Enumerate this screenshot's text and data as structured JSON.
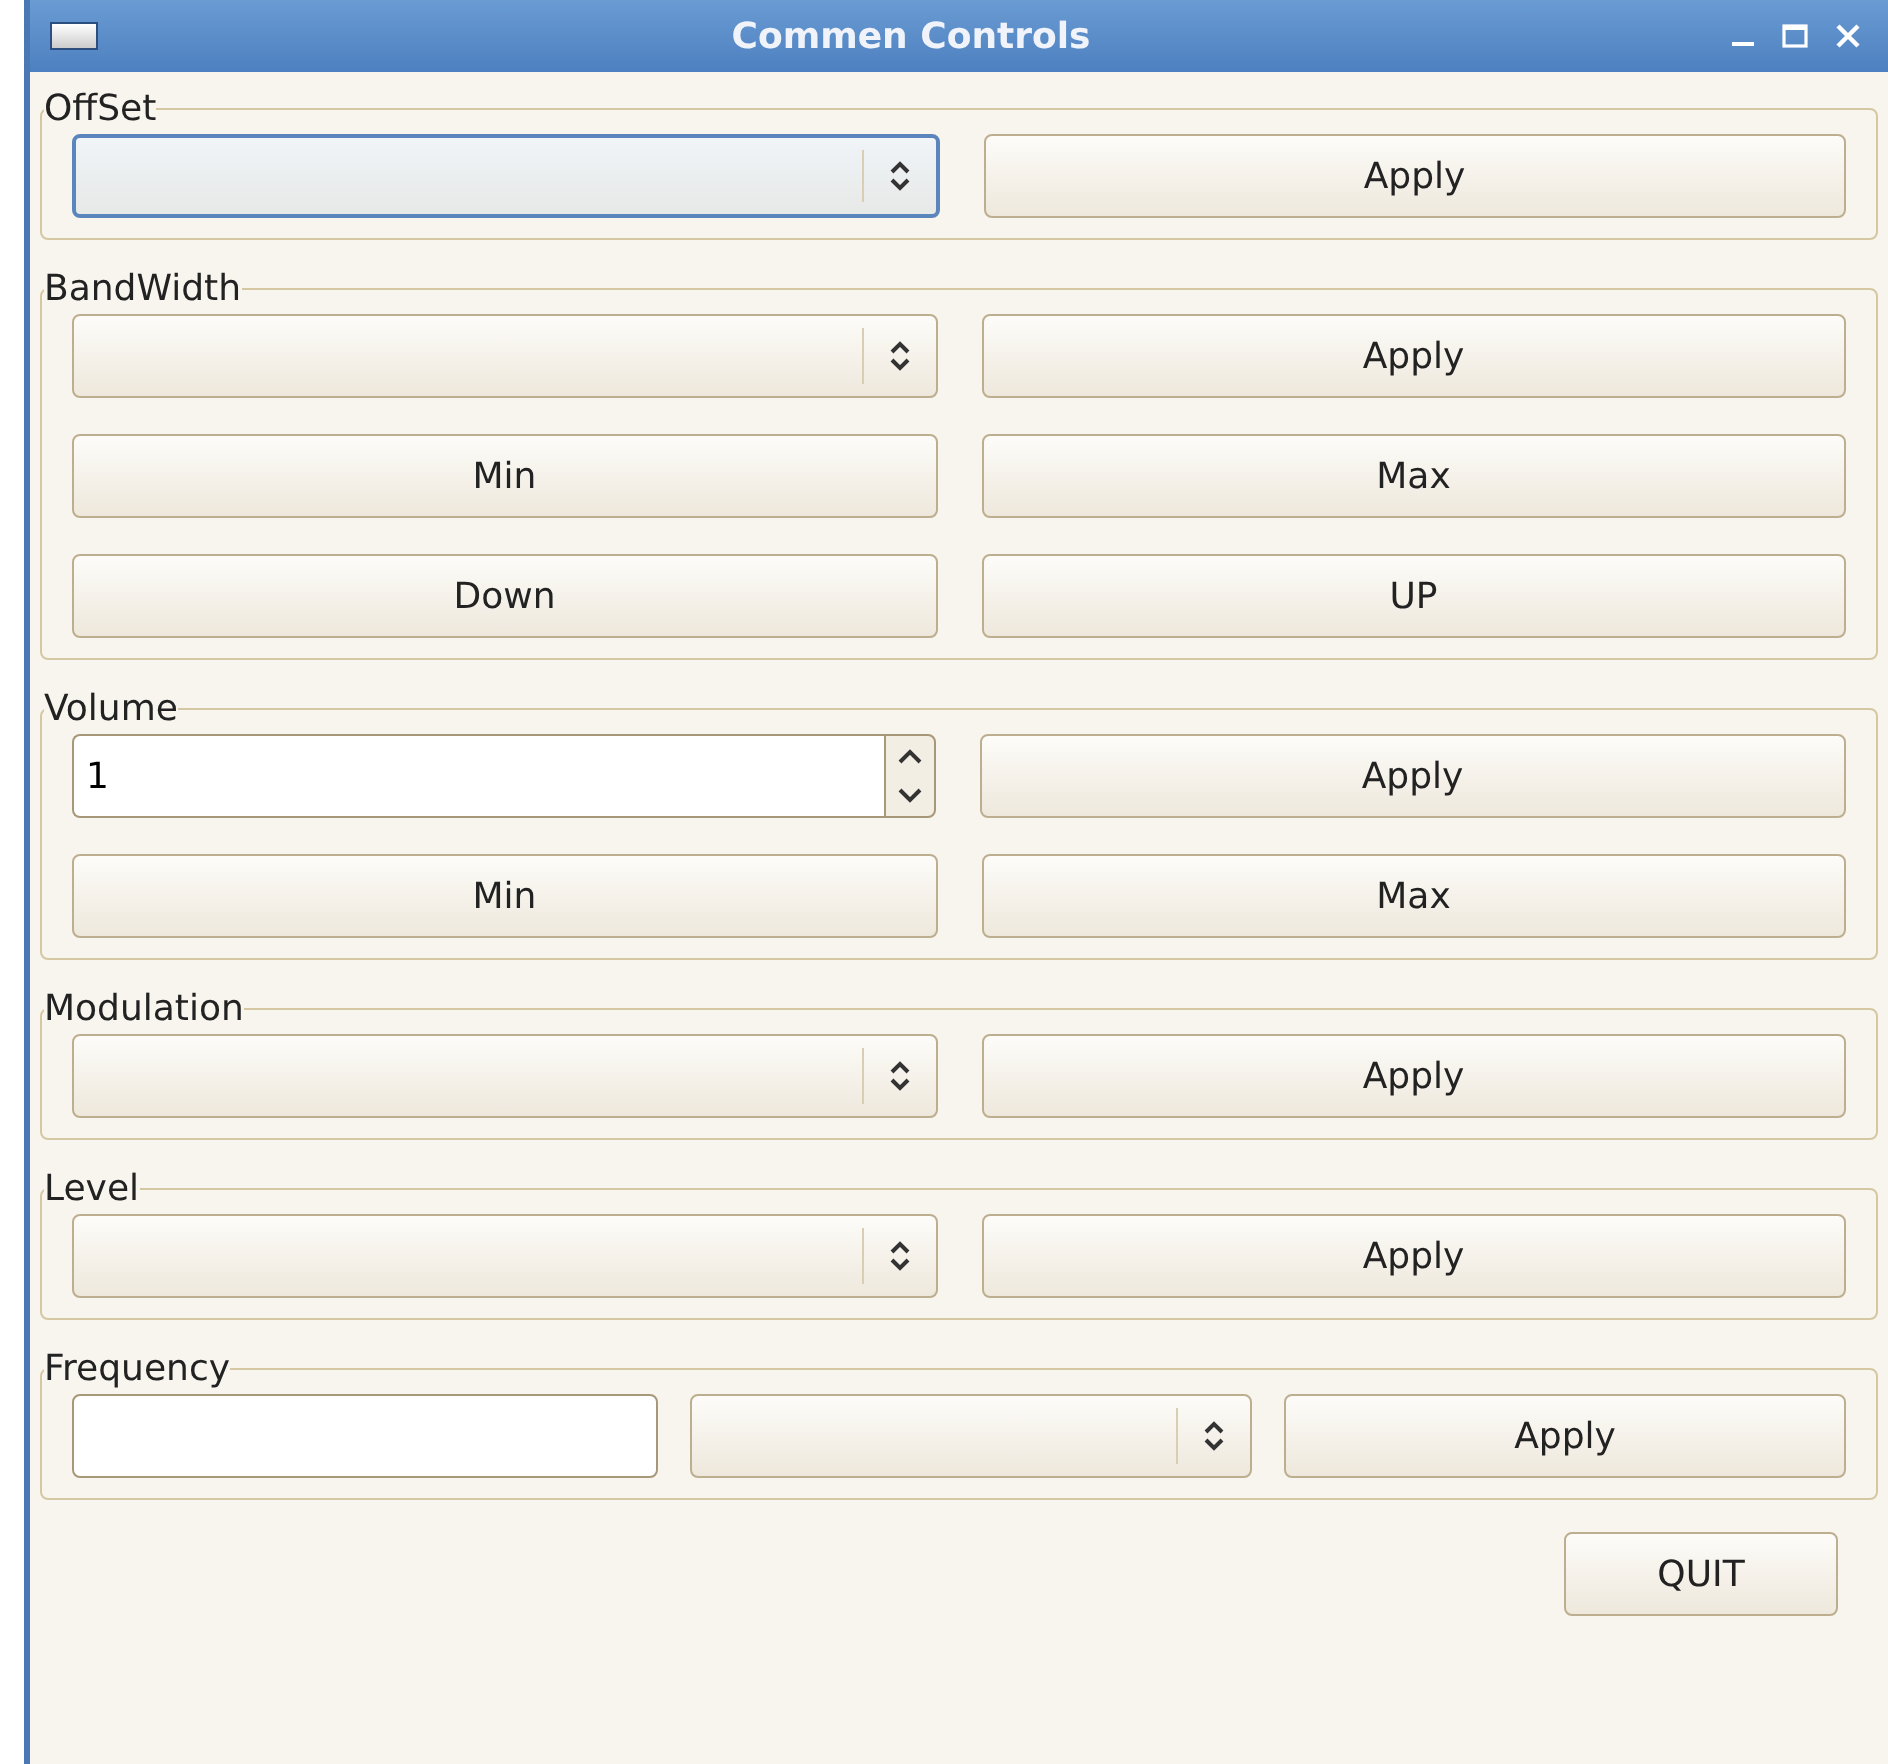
{
  "window": {
    "title": "Commen Controls"
  },
  "groups": [
    {
      "title": "OffSet",
      "rows": [
        [
          {
            "kind": "combo",
            "focused": true
          },
          {
            "kind": "button",
            "label": "Apply"
          }
        ]
      ]
    },
    {
      "title": "BandWidth",
      "rows": [
        [
          {
            "kind": "combo",
            "focused": false
          },
          {
            "kind": "button",
            "label": "Apply"
          }
        ],
        [
          {
            "kind": "button",
            "label": "Min"
          },
          {
            "kind": "button",
            "label": "Max"
          }
        ],
        [
          {
            "kind": "button",
            "label": "Down"
          },
          {
            "kind": "button",
            "label": "UP"
          }
        ]
      ]
    },
    {
      "title": "Volume",
      "rows": [
        [
          {
            "kind": "spin",
            "value": "1"
          },
          {
            "kind": "button",
            "label": "Apply"
          }
        ],
        [
          {
            "kind": "button",
            "label": "Min"
          },
          {
            "kind": "button",
            "label": "Max"
          }
        ]
      ]
    },
    {
      "title": "Modulation",
      "rows": [
        [
          {
            "kind": "combo",
            "focused": false
          },
          {
            "kind": "button",
            "label": "Apply"
          }
        ]
      ]
    },
    {
      "title": "Level",
      "rows": [
        [
          {
            "kind": "combo",
            "focused": false
          },
          {
            "kind": "button",
            "label": "Apply"
          }
        ]
      ]
    },
    {
      "title": "Frequency",
      "rows": [
        [
          {
            "kind": "text"
          },
          {
            "kind": "combo",
            "focused": false
          },
          {
            "kind": "button",
            "label": "Apply"
          }
        ]
      ]
    }
  ],
  "quit": {
    "label": "QUIT"
  }
}
